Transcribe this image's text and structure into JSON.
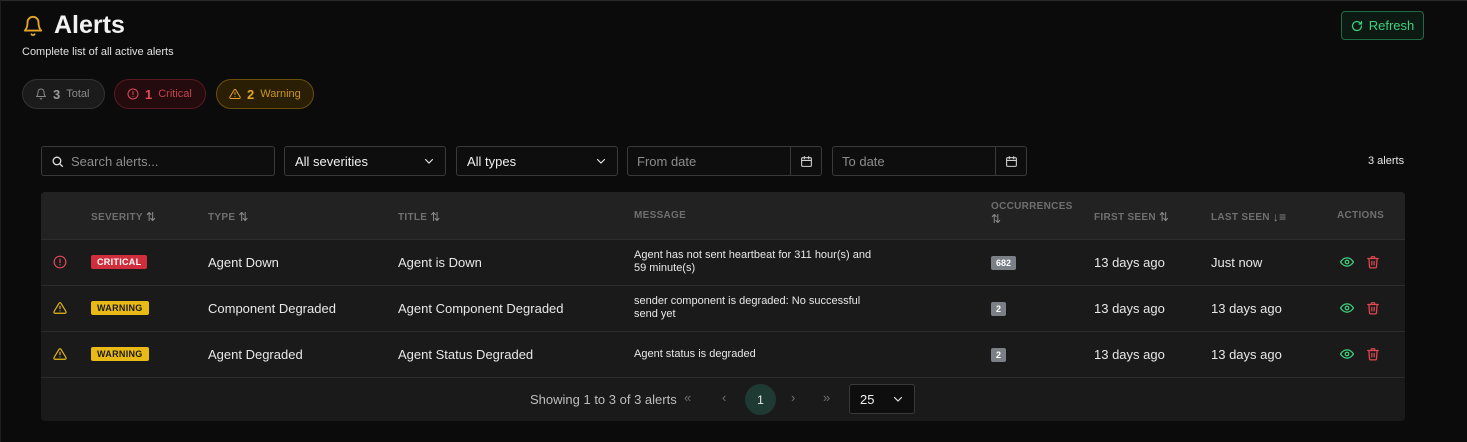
{
  "header": {
    "title": "Alerts",
    "subtitle": "Complete list of all active alerts",
    "refresh_label": "Refresh",
    "accent": "#e3a42a"
  },
  "summary": {
    "total": {
      "count": "3",
      "label": "Total"
    },
    "critical": {
      "count": "1",
      "label": "Critical"
    },
    "warning": {
      "count": "2",
      "label": "Warning"
    }
  },
  "filters": {
    "search_placeholder": "Search alerts...",
    "severity_selected": "All severities",
    "type_selected": "All types",
    "from_placeholder": "From date",
    "to_placeholder": "To date",
    "result_count": "3 alerts"
  },
  "table": {
    "columns": {
      "severity": "SEVERITY",
      "type": "TYPE",
      "title": "TITLE",
      "message": "MESSAGE",
      "occurrences": "OCCURRENCES",
      "first_seen": "FIRST SEEN",
      "last_seen": "LAST SEEN",
      "actions": "ACTIONS"
    },
    "rows": [
      {
        "severity": "CRITICAL",
        "severity_icon": "alert-circle-icon",
        "type": "Agent Down",
        "title": "Agent is Down",
        "message": "Agent has not sent heartbeat for 311 hour(s) and 59 minute(s)",
        "occurrences": "682",
        "first_seen": "13 days ago",
        "last_seen": "Just now"
      },
      {
        "severity": "WARNING",
        "severity_icon": "warning-triangle-icon",
        "type": "Component Degraded",
        "title": "Agent Component Degraded",
        "message": "sender component is degraded: No successful send yet",
        "occurrences": "2",
        "first_seen": "13 days ago",
        "last_seen": "13 days ago"
      },
      {
        "severity": "WARNING",
        "severity_icon": "warning-triangle-icon",
        "type": "Agent Degraded",
        "title": "Agent Status Degraded",
        "message": "Agent status is degraded",
        "occurrences": "2",
        "first_seen": "13 days ago",
        "last_seen": "13 days ago"
      }
    ]
  },
  "pagination": {
    "summary": "Showing 1 to 3 of 3 alerts",
    "current_page": "1",
    "page_size": "25"
  },
  "colors": {
    "critical": "#cf2e3d",
    "warning": "#e9b915",
    "success": "#3fcf7f",
    "danger_action": "#e0474f"
  }
}
